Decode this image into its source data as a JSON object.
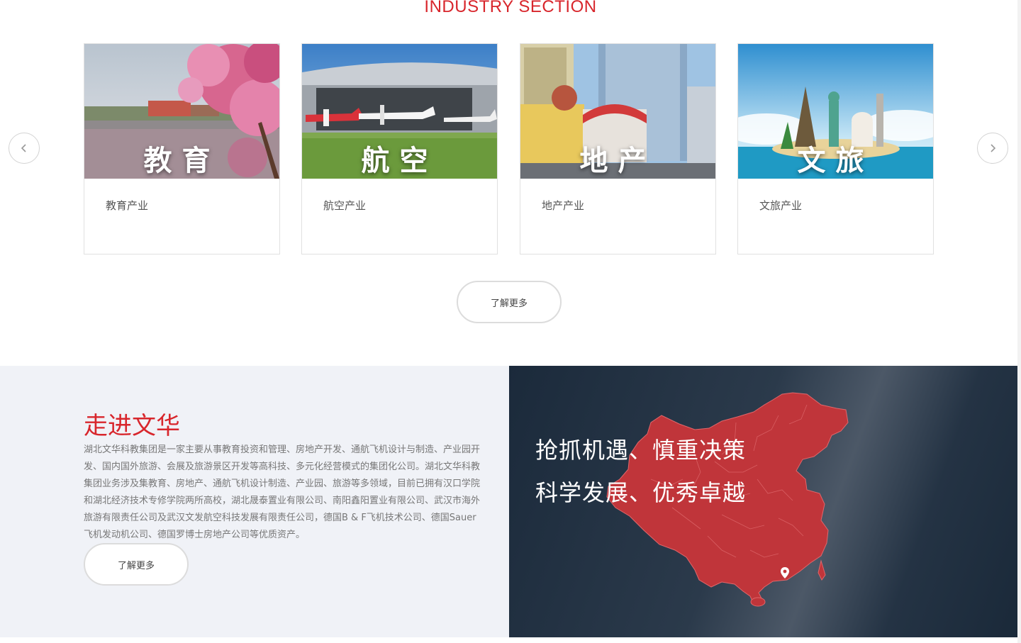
{
  "industry": {
    "title": "INDUSTRY SECTION",
    "prev_icon": "chevron-left-icon",
    "next_icon": "chevron-right-icon",
    "cards": [
      {
        "overlay": "教育",
        "caption": "教育产业"
      },
      {
        "overlay": "航空",
        "caption": "航空产业"
      },
      {
        "overlay": "地产",
        "caption": "地产产业"
      },
      {
        "overlay": "文旅",
        "caption": "文旅产业"
      }
    ],
    "more_label": "了解更多"
  },
  "about": {
    "title": "走进文华",
    "body": "湖北文华科教集团是一家主要从事教育投资和管理、房地产开发、通航飞机设计与制造、产业园开发、国内国外旅游、会展及旅游景区开发等高科技、多元化经营模式的集团化公司。湖北文华科教集团业务涉及集教育、房地产、通航飞机设计制造、产业园、旅游等多领域，目前已拥有汉口学院和湖北经济技术专修学院两所高校，湖北晟泰置业有限公司、南阳鑫阳置业有限公司、武汉市海外旅游有限责任公司及武汉文发航空科技发展有限责任公司，德国B & F飞机技术公司、德国Sauer飞机发动机公司、德国罗博士房地产公司等优质资产。",
    "more_label": "了解更多"
  },
  "slogan": {
    "line1": "抢抓机遇、慎重决策",
    "line2": "科学发展、优秀卓越",
    "map_icon": "china-map-icon",
    "marker_icon": "location-pin-icon"
  },
  "colors": {
    "accent": "#d8262c",
    "map": "#c0353a",
    "dark_panel": "#1f2e3f"
  }
}
